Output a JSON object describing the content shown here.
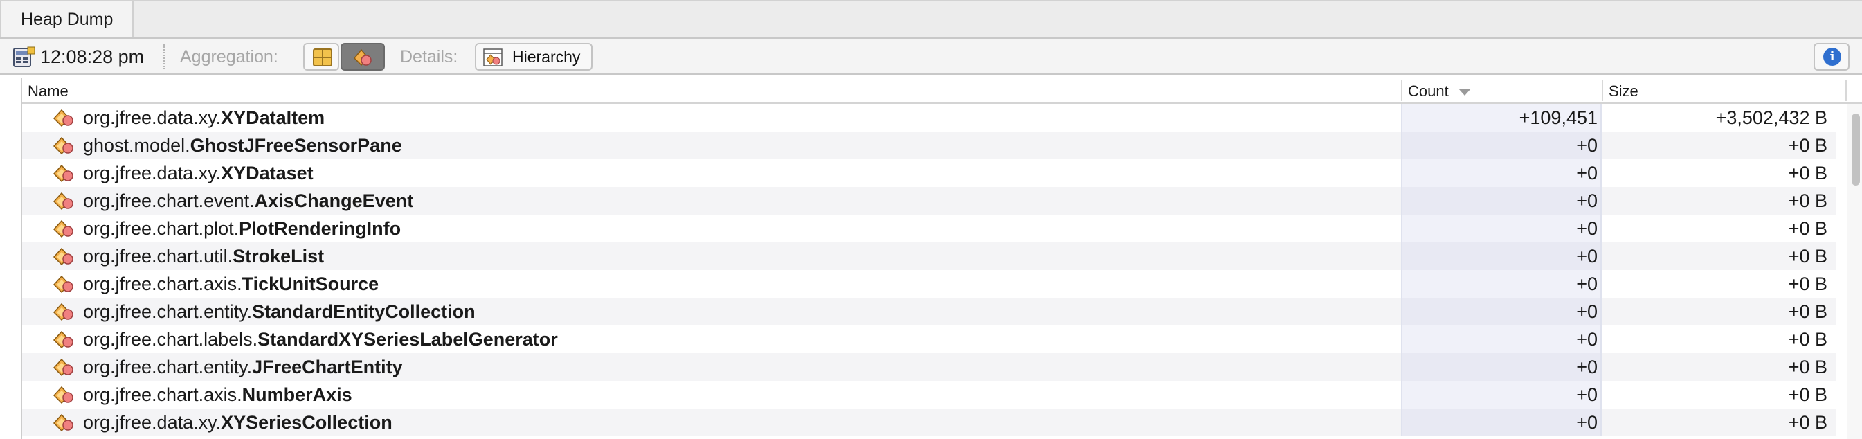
{
  "window": {
    "tab_title": "Heap Dump"
  },
  "toolbar": {
    "snapshot_time": "12:08:28 pm",
    "aggregation_label": "Aggregation:",
    "details_label": "Details:",
    "hierarchy_label": "Hierarchy",
    "info_glyph": "i"
  },
  "table": {
    "columns": {
      "name": "Name",
      "count": "Count",
      "size": "Size"
    },
    "sort_column": "Count",
    "sort_direction": "descending",
    "rows": [
      {
        "pkg": "org.jfree.data.xy.",
        "cls": "XYDataItem",
        "count": "+109,451",
        "size": "+3,502,432 B"
      },
      {
        "pkg": "ghost.model.",
        "cls": "GhostJFreeSensorPane",
        "count": "+0",
        "size": "+0 B"
      },
      {
        "pkg": "org.jfree.data.xy.",
        "cls": "XYDataset",
        "count": "+0",
        "size": "+0 B"
      },
      {
        "pkg": "org.jfree.chart.event.",
        "cls": "AxisChangeEvent",
        "count": "+0",
        "size": "+0 B"
      },
      {
        "pkg": "org.jfree.chart.plot.",
        "cls": "PlotRenderingInfo",
        "count": "+0",
        "size": "+0 B"
      },
      {
        "pkg": "org.jfree.chart.util.",
        "cls": "StrokeList",
        "count": "+0",
        "size": "+0 B"
      },
      {
        "pkg": "org.jfree.chart.axis.",
        "cls": "TickUnitSource",
        "count": "+0",
        "size": "+0 B"
      },
      {
        "pkg": "org.jfree.chart.entity.",
        "cls": "StandardEntityCollection",
        "count": "+0",
        "size": "+0 B"
      },
      {
        "pkg": "org.jfree.chart.labels.",
        "cls": "StandardXYSeriesLabelGenerator",
        "count": "+0",
        "size": "+0 B"
      },
      {
        "pkg": "org.jfree.chart.entity.",
        "cls": "JFreeChartEntity",
        "count": "+0",
        "size": "+0 B"
      },
      {
        "pkg": "org.jfree.chart.axis.",
        "cls": "NumberAxis",
        "count": "+0",
        "size": "+0 B"
      },
      {
        "pkg": "org.jfree.data.xy.",
        "cls": "XYSeriesCollection",
        "count": "+0",
        "size": "+0 B"
      }
    ]
  },
  "icons": {
    "snapshot": "heap-snapshot-icon",
    "aggregation_package": "package-aggregation-icon",
    "aggregation_class": "class-aggregation-icon",
    "hierarchy": "hierarchy-icon",
    "info": "info-icon",
    "class_row": "class-icon"
  },
  "colors": {
    "accent_blue": "#2f6fcf",
    "class_icon_orange": "#f0a040",
    "class_icon_pink": "#f08080",
    "active_button": "#7d7d7d"
  }
}
